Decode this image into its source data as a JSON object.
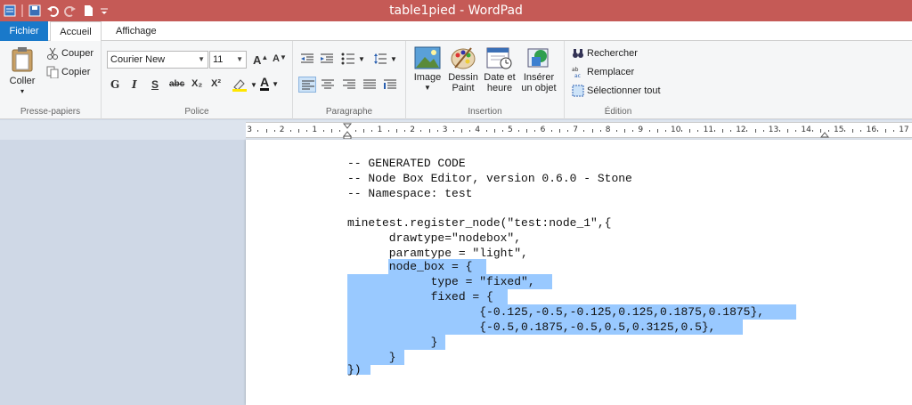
{
  "window": {
    "title": "table1pied - WordPad"
  },
  "quick_access": {
    "icons": [
      "wordpad-icon",
      "save-icon",
      "undo-icon",
      "redo-icon",
      "new-icon",
      "customize-icon"
    ]
  },
  "menu": {
    "file": "Fichier",
    "home": "Accueil",
    "view": "Affichage"
  },
  "clipboard": {
    "paste": "Coller",
    "cut": "Couper",
    "copy": "Copier",
    "label": "Presse-papiers"
  },
  "font": {
    "family": "Courier New",
    "size": "11",
    "grow": "A",
    "shrink": "A",
    "bold": "G",
    "italic": "I",
    "underline": "S",
    "strike": "abc",
    "subscript": "X₂",
    "superscript": "X²",
    "color": "A",
    "label": "Police"
  },
  "paragraph": {
    "label": "Paragraphe"
  },
  "insert": {
    "image": "Image",
    "paint_line1": "Dessin",
    "paint_line2": "Paint",
    "datetime_line1": "Date et",
    "datetime_line2": "heure",
    "object_line1": "Insérer",
    "object_line2": "un objet",
    "label": "Insertion"
  },
  "editing": {
    "find": "Rechercher",
    "replace": "Remplacer",
    "select_all": "Sélectionner tout",
    "label": "Édition"
  },
  "ruler": {
    "numbers": [
      "3",
      "2",
      "1",
      "1",
      "2",
      "3",
      "4",
      "5",
      "6",
      "7",
      "8",
      "9",
      "10",
      "11",
      "12",
      "13",
      "14",
      "15",
      "16",
      "17"
    ]
  },
  "document": {
    "lines": [
      "-- GENERATED CODE",
      "-- Node Box Editor, version 0.6.0 - Stone",
      "-- Namespace: test",
      "",
      "minetest.register_node(\"test:node_1\",{",
      "      drawtype=\"nodebox\",",
      "      paramtype = \"light\",",
      "      node_box = {",
      "            type = \"fixed\",",
      "            fixed = {",
      "                   {-0.125,-0.5,-0.125,0.125,0.1875,0.1875},",
      "                   {-0.5,0.1875,-0.5,0.5,0.3125,0.5},",
      "            }",
      "      }",
      "})"
    ]
  }
}
